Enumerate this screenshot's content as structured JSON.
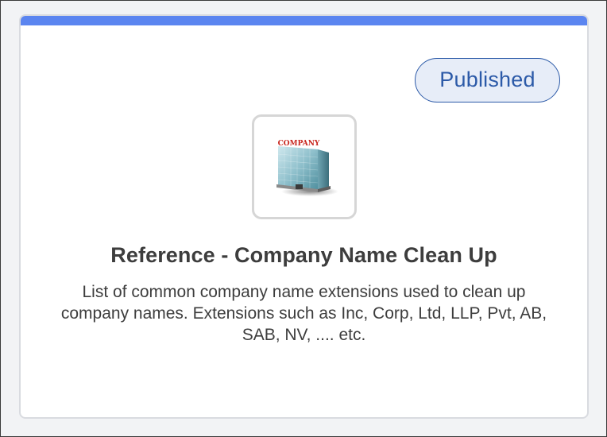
{
  "card": {
    "accent_color": "#5b85f0",
    "status_badge": "Published",
    "thumbnail_icon": "company-building-icon",
    "thumbnail_sign_text": "COMPANY",
    "title": "Reference - Company Name Clean Up",
    "description": "List of common company name extensions used to clean up company names. Extensions such as Inc, Corp, Ltd, LLP, Pvt, AB, SAB, NV, .... etc."
  }
}
